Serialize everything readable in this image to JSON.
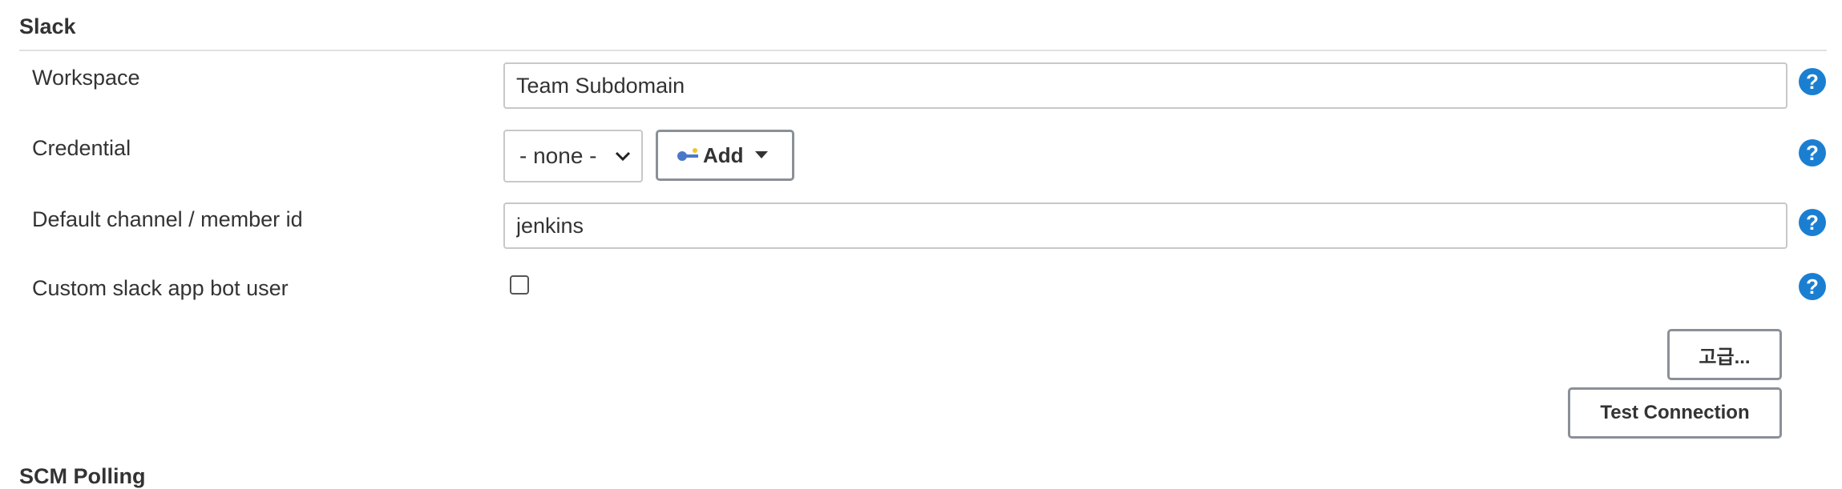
{
  "section": {
    "title": "Slack"
  },
  "fields": {
    "workspace": {
      "label": "Workspace",
      "value": "Team Subdomain"
    },
    "credential": {
      "label": "Credential",
      "selected": "- none -",
      "add_label": "Add"
    },
    "default_channel": {
      "label": "Default channel / member id",
      "value": "jenkins"
    },
    "custom_bot_user": {
      "label": "Custom slack app bot user",
      "checked": false
    }
  },
  "help": {
    "symbol": "?"
  },
  "buttons": {
    "advanced": "고급...",
    "test_connection": "Test Connection"
  },
  "next_section": {
    "title": "SCM Polling"
  },
  "colors": {
    "help_blue": "#1b7fd1",
    "border": "#c8c8c8",
    "button_border": "#8a9097"
  }
}
